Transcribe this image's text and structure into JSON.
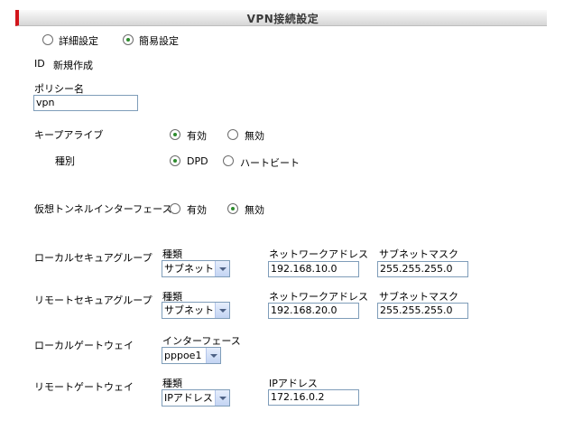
{
  "title": "VPN接続設定",
  "mode": {
    "detail": "詳細設定",
    "simple": "簡易設定",
    "selected": "simple"
  },
  "id_label": "ID",
  "id_value": "新規作成",
  "policy": {
    "label": "ポリシー名",
    "value": "vpn"
  },
  "keepalive": {
    "label": "キープアライブ",
    "enabled": "有効",
    "disabled": "無効",
    "selected": "enabled"
  },
  "type": {
    "label": "種別",
    "dpd": "DPD",
    "heartbeat": "ハートビート",
    "selected": "dpd"
  },
  "tunnel": {
    "label": "仮想トンネルインターフェース",
    "enabled": "有効",
    "disabled": "無効",
    "selected": "disabled"
  },
  "local_group": {
    "label": "ローカルセキュアグループ",
    "kind_label": "種類",
    "kind_value": "サブネット",
    "network_label": "ネットワークアドレス",
    "network_value": "192.168.10.0",
    "mask_label": "サブネットマスク",
    "mask_value": "255.255.255.0"
  },
  "remote_group": {
    "label": "リモートセキュアグループ",
    "kind_label": "種類",
    "kind_value": "サブネット",
    "network_label": "ネットワークアドレス",
    "network_value": "192.168.20.0",
    "mask_label": "サブネットマスク",
    "mask_value": "255.255.255.0"
  },
  "local_gateway": {
    "label": "ローカルゲートウェイ",
    "iface_label": "インターフェース",
    "iface_value": "pppoe1"
  },
  "remote_gateway": {
    "label": "リモートゲートウェイ",
    "kind_label": "種類",
    "kind_value": "IPアドレス",
    "ip_label": "IPアドレス",
    "ip_value": "172.16.0.2"
  }
}
